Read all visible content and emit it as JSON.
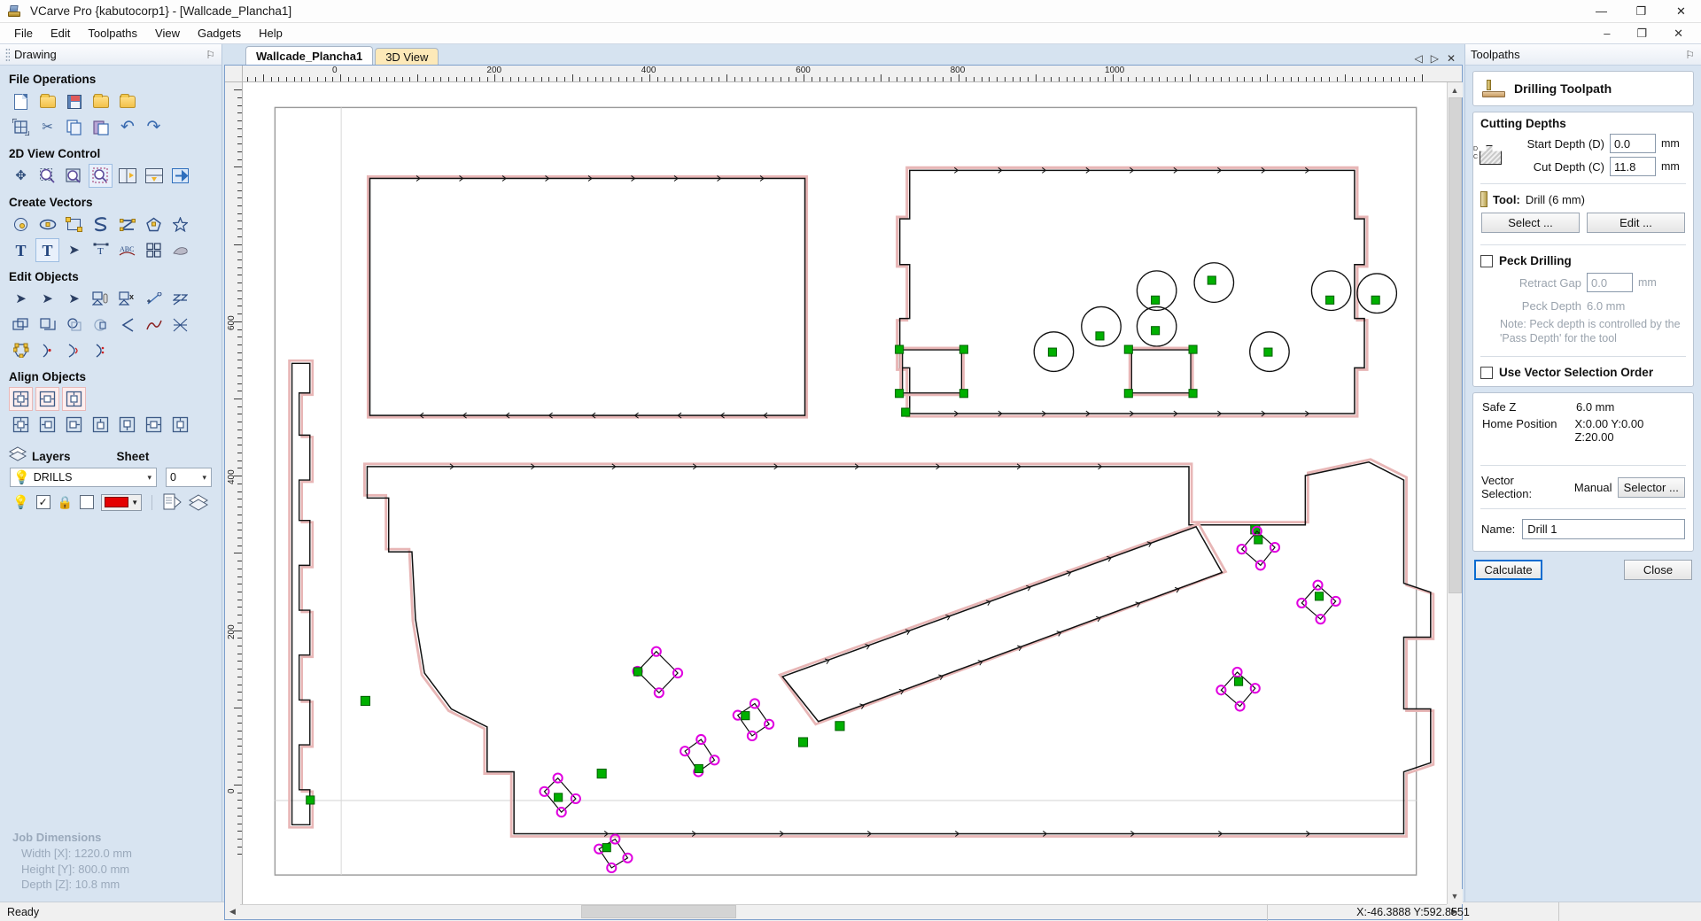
{
  "window": {
    "title": "VCarve Pro {kabutocorp1} - [Wallcade_Plancha1]",
    "minimize": "—",
    "maximize": "❐",
    "close": "✕",
    "restore_small": "–",
    "restore_box": "❐",
    "close_small": "✕"
  },
  "menu": {
    "items": [
      "File",
      "Edit",
      "Toolpaths",
      "View",
      "Gadgets",
      "Help"
    ]
  },
  "left_panel": {
    "header": {
      "title": "Drawing",
      "pin": "⚐"
    },
    "groups": [
      {
        "title": "File Operations",
        "rows": [
          [
            "new-file-icon",
            "open-file-icon",
            "save-file-icon",
            "open-recent-icon",
            "import-file-icon"
          ],
          [
            "job-setup-icon",
            "cut-icon",
            "copy-icon",
            "paste-icon",
            "undo-icon",
            "redo-icon"
          ]
        ]
      },
      {
        "title": "2D View Control",
        "rows": [
          [
            "pan-icon",
            "zoom-in-icon",
            "zoom-extents-icon",
            "zoom-selection-icon",
            "toggle-left-pane-icon",
            "toggle-bottom-pane-icon",
            "show-3d-view-icon"
          ]
        ]
      },
      {
        "title": "Create Vectors",
        "rows": [
          [
            "draw-circle-icon",
            "draw-ellipse-icon",
            "draw-rectangle-icon",
            "draw-polyline-icon",
            "draw-polygon-tool-icon",
            "draw-pentagon-icon",
            "draw-star-icon"
          ],
          [
            "create-text-icon",
            "edit-text-icon",
            "text-select-icon",
            "text-on-curve-icon",
            "text-on-arc-icon",
            "auto-layout-icon",
            "trace-bitmap-icon"
          ]
        ]
      },
      {
        "title": "Edit Objects",
        "rows": [
          [
            "select-node-icon",
            "edit-node-icon",
            "move-node-icon",
            "group-objects-icon",
            "ungroup-objects-icon",
            "join-vectors-icon",
            "zigzag-icon"
          ],
          [
            "offset-vectors-icon",
            "weld-vectors-icon",
            "subtract-vectors-icon",
            "intersect-vectors-icon",
            "fillet-icon",
            "curve-fit-icon",
            "trim-vectors-icon"
          ],
          [
            "array-copy-icon",
            "node-insert-icon",
            "node-curve-icon",
            "node-smooth-icon"
          ]
        ]
      },
      {
        "title": "Align Objects",
        "rows": [
          [
            "align-center-in-job-icon",
            "align-horizontal-center-job-icon",
            "align-vertical-center-job-icon"
          ],
          [
            "align-centers-icon",
            "align-left-icon",
            "align-right-icon",
            "align-top-icon",
            "align-bottom-icon",
            "align-h-centers-icon",
            "align-v-centers-icon"
          ]
        ]
      }
    ],
    "layers": {
      "title": "Layers",
      "sheet_title": "Sheet",
      "layer_value": "DRILLS",
      "sheet_value": "0",
      "bulb_icon": "💡",
      "check_icon": "✓",
      "lock_icon": "🔒",
      "layer_color": "#e40000",
      "dropdown_caret": "▼",
      "tool_icons": [
        "layer-properties-icon",
        "sheet-manager-icon"
      ]
    },
    "job_dimensions": {
      "title": "Job Dimensions",
      "rows": [
        "Width  [X]: 1220.0 mm",
        "Height [Y]: 800.0 mm",
        "Depth  [Z]: 10.8 mm"
      ]
    }
  },
  "tabs": {
    "items": [
      {
        "label": "Wallcade_Plancha1",
        "active": true
      },
      {
        "label": "3D View",
        "active": false
      }
    ],
    "nav": {
      "prev": "◁",
      "next": "▷",
      "close": "✕"
    }
  },
  "rulers": {
    "horizontal_labels": [
      "0",
      "200",
      "400",
      "600",
      "800",
      "1000"
    ],
    "vertical_labels": [
      "600",
      "400",
      "200",
      "0"
    ],
    "units": "mm"
  },
  "right_panel": {
    "header": {
      "title": "Toolpaths",
      "pin": "⚐"
    },
    "toolpath_title": "Drilling Toolpath",
    "cutting_depths": {
      "title": "Cutting Depths",
      "start_depth_label": "Start Depth (D)",
      "start_depth_value": "0.0",
      "start_depth_unit": "mm",
      "cut_depth_label": "Cut Depth (C)",
      "cut_depth_value": "11.8",
      "cut_depth_unit": "mm",
      "diagram_d": "D",
      "diagram_c": "C"
    },
    "tool": {
      "label": "Tool:",
      "value": "Drill (6 mm)",
      "select_button": "Select ...",
      "edit_button": "Edit ..."
    },
    "peck_drilling": {
      "label": "Peck Drilling",
      "checked": false,
      "retract_gap_label": "Retract Gap",
      "retract_gap_value": "0.0",
      "retract_gap_unit": "mm",
      "peck_depth_label": "Peck Depth",
      "peck_depth_value": "6.0 mm",
      "note": "Note: Peck depth is controlled by the 'Pass Depth' for the tool"
    },
    "use_vector_selection_order": {
      "label": "Use Vector Selection Order",
      "checked": false
    },
    "position": {
      "safe_z_label": "Safe Z",
      "safe_z_value": "6.0 mm",
      "home_position_label": "Home Position",
      "home_position_value": "X:0.00 Y:0.00 Z:20.00"
    },
    "vector_selection": {
      "label": "Vector Selection:",
      "value": "Manual",
      "selector_button": "Selector ..."
    },
    "name": {
      "label": "Name:",
      "value": "Drill 1"
    },
    "actions": {
      "calculate": "Calculate",
      "close": "Close"
    }
  },
  "status_bar": {
    "message": "Ready",
    "coordinates": "X:-46.3888 Y:592.8551"
  },
  "drawing": {
    "material_color": "#ffffff",
    "vector_color": "#000000",
    "toolpath_color": "#e8b6b6",
    "start_node_color": "#00b000",
    "drill_node_color": "#e000e0"
  }
}
